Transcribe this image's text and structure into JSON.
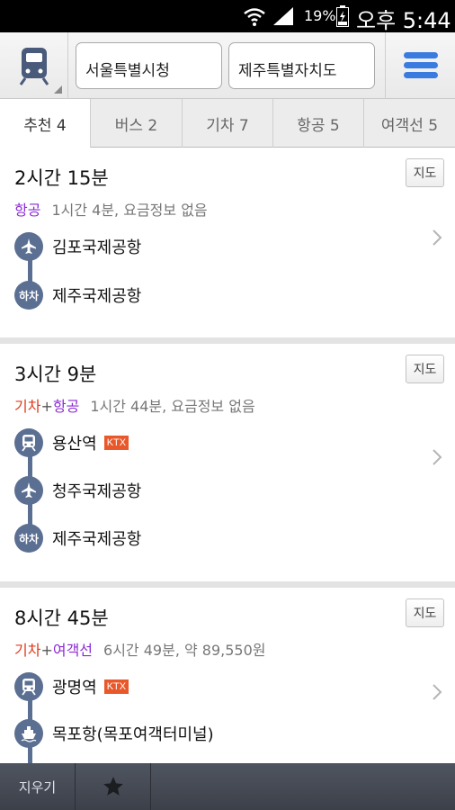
{
  "status": {
    "battery_percent": "19%",
    "time": "오후 5:44"
  },
  "header": {
    "origin": "서울특별시청",
    "destination": "제주특별자치도"
  },
  "tabs": [
    {
      "label": "추천 4",
      "active": true
    },
    {
      "label": "버스 2",
      "active": false
    },
    {
      "label": "기차 7",
      "active": false
    },
    {
      "label": "항공 5",
      "active": false
    },
    {
      "label": "여객선 5",
      "active": false
    }
  ],
  "routes": [
    {
      "duration": "2시간 15분",
      "modes": {
        "first": "항공"
      },
      "detail": "1시간 4분, 요금정보 없음",
      "map_label": "지도",
      "stops": [
        {
          "icon": "airplane-icon",
          "name": "김포국제공항"
        },
        {
          "icon_text": "하차",
          "name": "제주국제공항"
        }
      ]
    },
    {
      "duration": "3시간 9분",
      "modes": {
        "first": "기차",
        "plus": "+",
        "second": "항공"
      },
      "detail": "1시간 44분, 요금정보 없음",
      "map_label": "지도",
      "stops": [
        {
          "icon": "train-icon",
          "name": "용산역",
          "badge": "KTX"
        },
        {
          "icon": "airplane-icon",
          "name": "청주국제공항"
        },
        {
          "icon_text": "하차",
          "name": "제주국제공항"
        }
      ]
    },
    {
      "duration": "8시간 45분",
      "modes": {
        "first": "기차",
        "plus": "+",
        "second": "여객선"
      },
      "detail": "6시간 49분, 약 89,550원",
      "map_label": "지도",
      "stops": [
        {
          "icon": "train-icon",
          "name": "광명역",
          "badge": "KTX"
        },
        {
          "icon": "ship-icon",
          "name": "목포항(목포여객터미널)"
        }
      ]
    }
  ],
  "bottom": {
    "clear_label": "지우기",
    "favorite_icon": "star-icon"
  },
  "colors": {
    "line": "#5b6f92",
    "air": "#8b2ad6",
    "train": "#e03a1a",
    "ktx": "#e8582a",
    "menu": "#3a7be0"
  }
}
